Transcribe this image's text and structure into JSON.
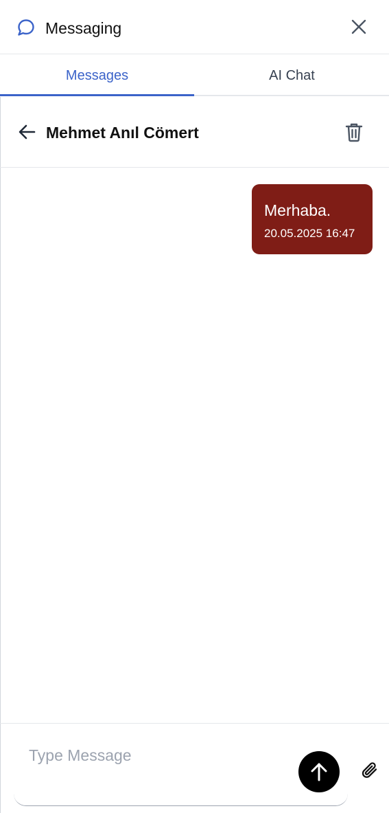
{
  "header": {
    "title": "Messaging"
  },
  "tabs": [
    {
      "label": "Messages",
      "active": true
    },
    {
      "label": "AI Chat",
      "active": false
    }
  ],
  "conversation": {
    "contact_name": "Mehmet Anıl Cömert",
    "messages": [
      {
        "text": "Merhaba.",
        "timestamp": "20.05.2025 16:47",
        "sender": "me"
      }
    ]
  },
  "composer": {
    "placeholder": "Type Message",
    "value": ""
  },
  "colors": {
    "accent": "#3b63c9",
    "outgoing_bubble": "#7f1d16",
    "send_button": "#000000"
  },
  "icons": {
    "header": "chat-bubble-icon",
    "close": "close-icon",
    "back": "arrow-left-icon",
    "delete": "trash-icon",
    "send": "arrow-up-icon",
    "attach": "paperclip-icon"
  }
}
